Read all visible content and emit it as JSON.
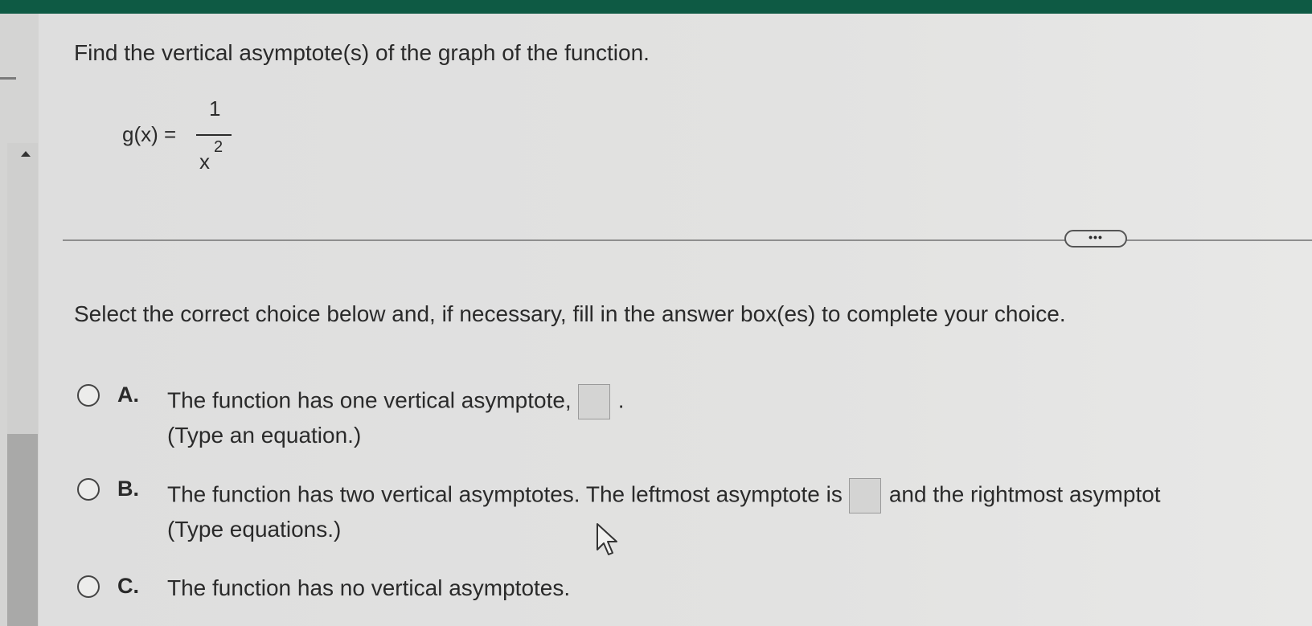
{
  "question": {
    "instruction": "Find the vertical asymptote(s) of the graph of the function.",
    "function_lhs": "g(x) =",
    "numerator": "1",
    "denominator_base": "x",
    "denominator_exponent": "2"
  },
  "more_button_label": "•••",
  "prompt": "Select the correct choice below and, if necessary, fill in the answer box(es) to complete your choice.",
  "choices": [
    {
      "letter": "A.",
      "text_before": "The function has one vertical asymptote,",
      "text_after": ".",
      "hint": "(Type an equation.)"
    },
    {
      "letter": "B.",
      "text_before": "The function has two vertical asymptotes. The leftmost asymptote is",
      "text_after": "and the rightmost asymptot",
      "hint": "(Type equations.)"
    },
    {
      "letter": "C.",
      "text": "The function has no vertical asymptotes."
    }
  ],
  "icons": {
    "scroll_up": "up-arrow-icon",
    "pointer": "mouse-pointer-icon"
  },
  "colors": {
    "top_bar": "#0e5a44",
    "background": "#dcdcdb",
    "text": "#2a2a2a"
  }
}
